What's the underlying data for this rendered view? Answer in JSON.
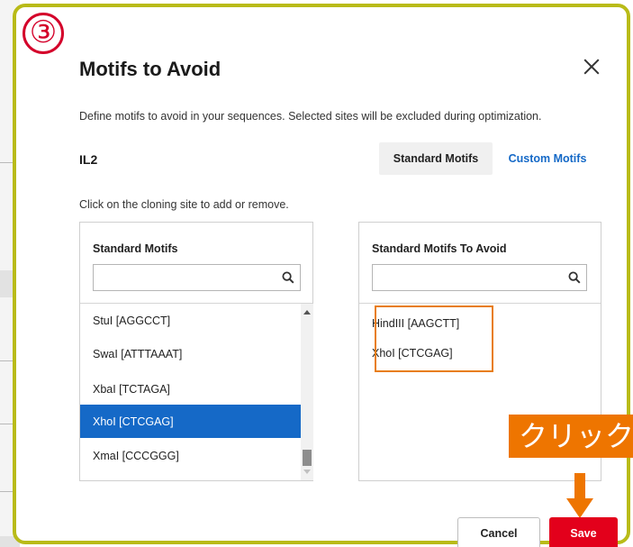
{
  "step_badge": "③",
  "modal": {
    "title": "Motifs to Avoid",
    "description": "Define motifs to avoid in your sequences. Selected sites will be excluded during optimization.",
    "sequence_name": "IL2",
    "tabs": [
      {
        "label": "Standard Motifs",
        "active": true
      },
      {
        "label": "Custom Motifs",
        "active": false
      }
    ],
    "instruction": "Click on the cloning site to add or remove."
  },
  "left_panel": {
    "header": "Standard Motifs",
    "search_value": "",
    "items": [
      {
        "label": "StuI [AGGCCT]",
        "selected": false
      },
      {
        "label": "SwaI [ATTTAAAT]",
        "selected": false
      },
      {
        "label": "XbaI [TCTAGA]",
        "selected": false
      },
      {
        "label": "XhoI [CTCGAG]",
        "selected": true
      },
      {
        "label": "XmaI [CCCGGG]",
        "selected": false
      }
    ]
  },
  "right_panel": {
    "header": "Standard Motifs To Avoid",
    "search_value": "",
    "items": [
      {
        "label": "HindIII [AAGCTT]"
      },
      {
        "label": "XhoI [CTCGAG]"
      }
    ]
  },
  "callout": {
    "label": "クリック"
  },
  "footer": {
    "cancel_label": "Cancel",
    "save_label": "Save"
  },
  "colors": {
    "accent_blue": "#1569c7",
    "save_red": "#e3001b",
    "callout_orange": "#ee7500",
    "frame_olive": "#b9bb19",
    "badge_red": "#d4002a"
  },
  "icons": {
    "close": "close-icon",
    "search": "search-icon",
    "arrow": "arrow-down-icon"
  }
}
